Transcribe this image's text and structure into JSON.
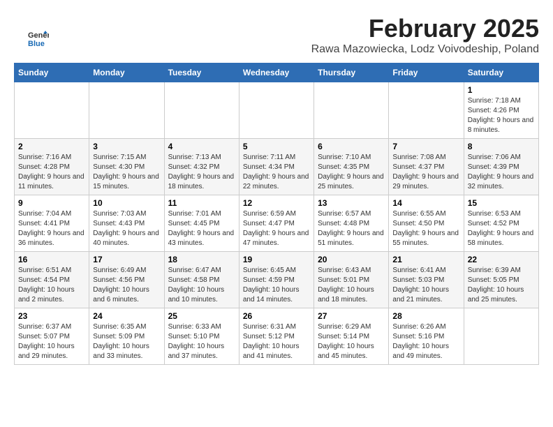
{
  "logo": {
    "line1": "General",
    "line2": "Blue"
  },
  "header": {
    "title": "February 2025",
    "location": "Rawa Mazowiecka, Lodz Voivodeship, Poland"
  },
  "weekdays": [
    "Sunday",
    "Monday",
    "Tuesday",
    "Wednesday",
    "Thursday",
    "Friday",
    "Saturday"
  ],
  "weeks": [
    [
      {
        "day": "",
        "info": ""
      },
      {
        "day": "",
        "info": ""
      },
      {
        "day": "",
        "info": ""
      },
      {
        "day": "",
        "info": ""
      },
      {
        "day": "",
        "info": ""
      },
      {
        "day": "",
        "info": ""
      },
      {
        "day": "1",
        "info": "Sunrise: 7:18 AM\nSunset: 4:26 PM\nDaylight: 9 hours and 8 minutes."
      }
    ],
    [
      {
        "day": "2",
        "info": "Sunrise: 7:16 AM\nSunset: 4:28 PM\nDaylight: 9 hours and 11 minutes."
      },
      {
        "day": "3",
        "info": "Sunrise: 7:15 AM\nSunset: 4:30 PM\nDaylight: 9 hours and 15 minutes."
      },
      {
        "day": "4",
        "info": "Sunrise: 7:13 AM\nSunset: 4:32 PM\nDaylight: 9 hours and 18 minutes."
      },
      {
        "day": "5",
        "info": "Sunrise: 7:11 AM\nSunset: 4:34 PM\nDaylight: 9 hours and 22 minutes."
      },
      {
        "day": "6",
        "info": "Sunrise: 7:10 AM\nSunset: 4:35 PM\nDaylight: 9 hours and 25 minutes."
      },
      {
        "day": "7",
        "info": "Sunrise: 7:08 AM\nSunset: 4:37 PM\nDaylight: 9 hours and 29 minutes."
      },
      {
        "day": "8",
        "info": "Sunrise: 7:06 AM\nSunset: 4:39 PM\nDaylight: 9 hours and 32 minutes."
      }
    ],
    [
      {
        "day": "9",
        "info": "Sunrise: 7:04 AM\nSunset: 4:41 PM\nDaylight: 9 hours and 36 minutes."
      },
      {
        "day": "10",
        "info": "Sunrise: 7:03 AM\nSunset: 4:43 PM\nDaylight: 9 hours and 40 minutes."
      },
      {
        "day": "11",
        "info": "Sunrise: 7:01 AM\nSunset: 4:45 PM\nDaylight: 9 hours and 43 minutes."
      },
      {
        "day": "12",
        "info": "Sunrise: 6:59 AM\nSunset: 4:47 PM\nDaylight: 9 hours and 47 minutes."
      },
      {
        "day": "13",
        "info": "Sunrise: 6:57 AM\nSunset: 4:48 PM\nDaylight: 9 hours and 51 minutes."
      },
      {
        "day": "14",
        "info": "Sunrise: 6:55 AM\nSunset: 4:50 PM\nDaylight: 9 hours and 55 minutes."
      },
      {
        "day": "15",
        "info": "Sunrise: 6:53 AM\nSunset: 4:52 PM\nDaylight: 9 hours and 58 minutes."
      }
    ],
    [
      {
        "day": "16",
        "info": "Sunrise: 6:51 AM\nSunset: 4:54 PM\nDaylight: 10 hours and 2 minutes."
      },
      {
        "day": "17",
        "info": "Sunrise: 6:49 AM\nSunset: 4:56 PM\nDaylight: 10 hours and 6 minutes."
      },
      {
        "day": "18",
        "info": "Sunrise: 6:47 AM\nSunset: 4:58 PM\nDaylight: 10 hours and 10 minutes."
      },
      {
        "day": "19",
        "info": "Sunrise: 6:45 AM\nSunset: 4:59 PM\nDaylight: 10 hours and 14 minutes."
      },
      {
        "day": "20",
        "info": "Sunrise: 6:43 AM\nSunset: 5:01 PM\nDaylight: 10 hours and 18 minutes."
      },
      {
        "day": "21",
        "info": "Sunrise: 6:41 AM\nSunset: 5:03 PM\nDaylight: 10 hours and 21 minutes."
      },
      {
        "day": "22",
        "info": "Sunrise: 6:39 AM\nSunset: 5:05 PM\nDaylight: 10 hours and 25 minutes."
      }
    ],
    [
      {
        "day": "23",
        "info": "Sunrise: 6:37 AM\nSunset: 5:07 PM\nDaylight: 10 hours and 29 minutes."
      },
      {
        "day": "24",
        "info": "Sunrise: 6:35 AM\nSunset: 5:09 PM\nDaylight: 10 hours and 33 minutes."
      },
      {
        "day": "25",
        "info": "Sunrise: 6:33 AM\nSunset: 5:10 PM\nDaylight: 10 hours and 37 minutes."
      },
      {
        "day": "26",
        "info": "Sunrise: 6:31 AM\nSunset: 5:12 PM\nDaylight: 10 hours and 41 minutes."
      },
      {
        "day": "27",
        "info": "Sunrise: 6:29 AM\nSunset: 5:14 PM\nDaylight: 10 hours and 45 minutes."
      },
      {
        "day": "28",
        "info": "Sunrise: 6:26 AM\nSunset: 5:16 PM\nDaylight: 10 hours and 49 minutes."
      },
      {
        "day": "",
        "info": ""
      }
    ]
  ]
}
